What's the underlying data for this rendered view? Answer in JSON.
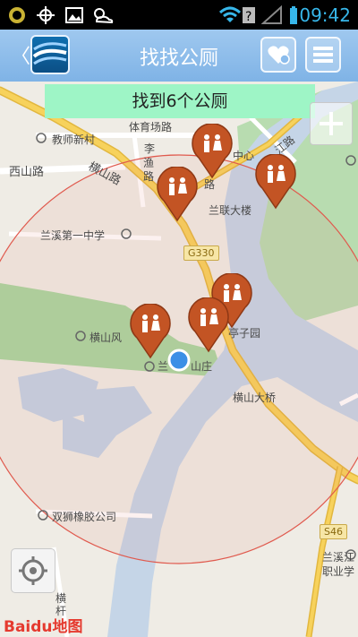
{
  "status_bar": {
    "time": "09:42"
  },
  "header": {
    "title": "找找公厕",
    "back_glyph": "〈"
  },
  "banner": {
    "text": "找到6个公厕"
  },
  "map": {
    "labels": [
      {
        "text": "体育场路",
        "id": "lbl-tiyuchang"
      },
      {
        "text": "教师新村",
        "id": "lbl-jiaoshi"
      },
      {
        "text": "李",
        "id": "lbl-li"
      },
      {
        "text": "渔",
        "id": "lbl-yu"
      },
      {
        "text": "路",
        "id": "lbl-lu"
      },
      {
        "text": "中心",
        "id": "lbl-zhongxin"
      },
      {
        "text": "江路",
        "id": "lbl-jianglu"
      },
      {
        "text": "西山路",
        "id": "lbl-xishan"
      },
      {
        "text": "横山路",
        "id": "lbl-hengshan"
      },
      {
        "text": "路",
        "id": "lbl-lu2"
      },
      {
        "text": "兰联大楼",
        "id": "lbl-lanlian"
      },
      {
        "text": "兰溪第一中学",
        "id": "lbl-yizhong"
      },
      {
        "text": "G330",
        "id": "lbl-g330"
      },
      {
        "text": "横山风",
        "id": "lbl-hengshanfeng"
      },
      {
        "text": "亭子园",
        "id": "lbl-tingziyuan"
      },
      {
        "text": "兰",
        "id": "lbl-lan"
      },
      {
        "text": "山庄",
        "id": "lbl-shanzhuang"
      },
      {
        "text": "横山大桥",
        "id": "lbl-daqiao"
      },
      {
        "text": "双狮橡胶公司",
        "id": "lbl-shuangshi"
      },
      {
        "text": "S46",
        "id": "lbl-s46"
      },
      {
        "text": "兰溪江",
        "id": "lbl-lanxijiang"
      },
      {
        "text": "职业学",
        "id": "lbl-zhiye"
      },
      {
        "text": "横",
        "id": "lbl-heng"
      },
      {
        "text": "杆",
        "id": "lbl-gan"
      }
    ],
    "toilet_count": 6
  },
  "colors": {
    "marker": "#c35424",
    "header": "#8bbcec",
    "banner": "#9ef5c6",
    "road_main": "#f7d25c",
    "water": "#c2d3e6",
    "park": "#a9d7a1",
    "radius": "#e05a4e"
  },
  "icons": {
    "wifi": "wifi-icon",
    "battery": "battery-icon",
    "heart": "favorite-icon",
    "menu": "menu-icon",
    "zoom": "zoom-icon",
    "locate": "locate-icon",
    "location_dot": "current-location-icon",
    "toilet": "toilet-marker-icon"
  },
  "baidu": {
    "text": "Baidu地图"
  }
}
